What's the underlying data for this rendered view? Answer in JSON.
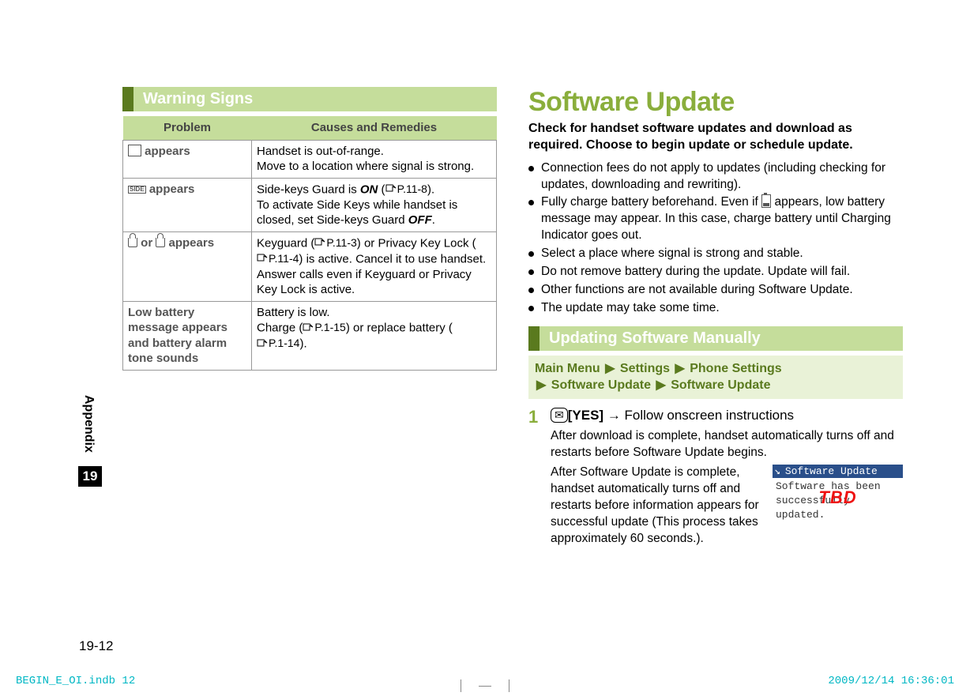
{
  "leftSection": {
    "heading": "Warning Signs",
    "table": {
      "headers": {
        "problem": "Problem",
        "remedy": "Causes and Remedies"
      },
      "rows": [
        {
          "problem_suffix": " appears",
          "remedy_l1": "Handset is out-of-range.",
          "remedy_l2": "Move to a location where signal is strong."
        },
        {
          "problem_suffix": " appears",
          "remedy_l1_a": "Side-keys Guard is ",
          "remedy_l1_on": "ON",
          "remedy_l1_b": " (",
          "remedy_l1_ref": "P.11-8",
          "remedy_l1_c": ").",
          "remedy_l2": "To activate Side Keys while handset is closed, set Side-keys Guard ",
          "remedy_l2_off": "OFF",
          "remedy_l2_end": "."
        },
        {
          "problem_mid": " or ",
          "problem_suffix": " appears",
          "remedy_l1_a": "Keyguard (",
          "remedy_l1_ref1": "P.11-3",
          "remedy_l1_b": ") or Privacy Key Lock (",
          "remedy_l1_ref2": "P.11-4",
          "remedy_l1_c": ") is active.  Cancel it to use handset.",
          "remedy_l2": "Answer calls even if Keyguard or Privacy Key Lock is active."
        },
        {
          "problem": "Low battery message appears and battery alarm tone sounds",
          "remedy_l1": "Battery is low.",
          "remedy_l2_a": "Charge (",
          "remedy_l2_ref1": "P.1-15",
          "remedy_l2_b": ") or replace battery (",
          "remedy_l2_ref2": "P.1-14",
          "remedy_l2_c": ")."
        }
      ]
    }
  },
  "rightSection": {
    "title": "Software Update",
    "subtitle": "Check for handset software updates and download as required. Choose to begin update or schedule update.",
    "bullets": [
      "Connection fees do not apply to updates (including checking for updates, downloading and rewriting).",
      "Fully charge battery beforehand. Even if   appears, low battery message may appear. In this case, charge battery until Charging Indicator goes out.",
      "Select a place where signal is strong and stable.",
      "Do not remove battery during the update. Update will fail.",
      "Other functions are not available during Software Update.",
      "The update may take some time."
    ],
    "subheading": "Updating Software Manually",
    "crumb": {
      "a": "Main Menu",
      "b": "Settings",
      "c": "Phone Settings",
      "d": "Software Update",
      "e": "Software Update"
    },
    "step": {
      "num": "1",
      "key_label": "[YES]",
      "arrow": "→",
      "rest": " Follow onscreen instructions",
      "para1": "After download is complete, handset automatically turns off and restarts before Software Update begins.",
      "para2": "After Software Update is complete, handset automatically turns off and restarts before information appears for successful update (This process takes approximately 60 seconds.).",
      "screen": {
        "header": "Software Update",
        "line1": "Software has been",
        "line2": "successfully updated.",
        "tbd": "TBD"
      }
    }
  },
  "margin": {
    "tab": "Appendix",
    "chapter": "19",
    "pageNum": "19-12"
  },
  "footer": {
    "left": "BEGIN_E_OI.indb   12",
    "right": "2009/12/14   16:36:01"
  }
}
